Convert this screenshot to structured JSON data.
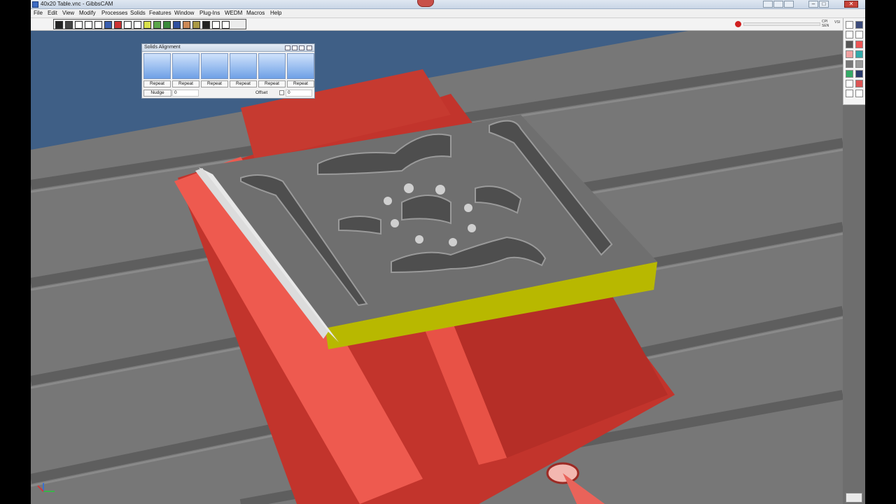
{
  "window": {
    "title": "40x20 Table.vnc - GibbsCAM",
    "min_symbol": "–",
    "max_symbol": "□",
    "close_symbol": "✕"
  },
  "menu": [
    "File",
    "Edit",
    "View",
    "Modify",
    "Processes",
    "Solids",
    "Features",
    "Window",
    "Plug-Ins",
    "WEDM",
    "Macros",
    "Help"
  ],
  "toolbar": {
    "readout_1": "CPI",
    "readout_2": "SEN",
    "readout_3": "VSI"
  },
  "solids_alignment": {
    "title": "Solids Alignment",
    "tools": [
      {
        "name": "align-face-icon",
        "repeat": "Repeat"
      },
      {
        "name": "align-edge-icon",
        "repeat": "Repeat"
      },
      {
        "name": "align-corner-icon",
        "repeat": "Repeat"
      },
      {
        "name": "align-axis-icon",
        "repeat": "Repeat"
      },
      {
        "name": "align-box-icon",
        "repeat": "Repeat"
      },
      {
        "name": "align-plane-icon",
        "repeat": "Repeat"
      }
    ],
    "nudge_label": "Nudge",
    "nudge_value": "0",
    "offset_label": "Offset",
    "offset_value": "0"
  },
  "colors": {
    "table": "#7a7a7a",
    "vise": "#c2342c",
    "vise_light": "#ee5a4f",
    "part": "#6f6f6f",
    "stock_edge": "#b8b800",
    "sky": "#3f5f86"
  }
}
